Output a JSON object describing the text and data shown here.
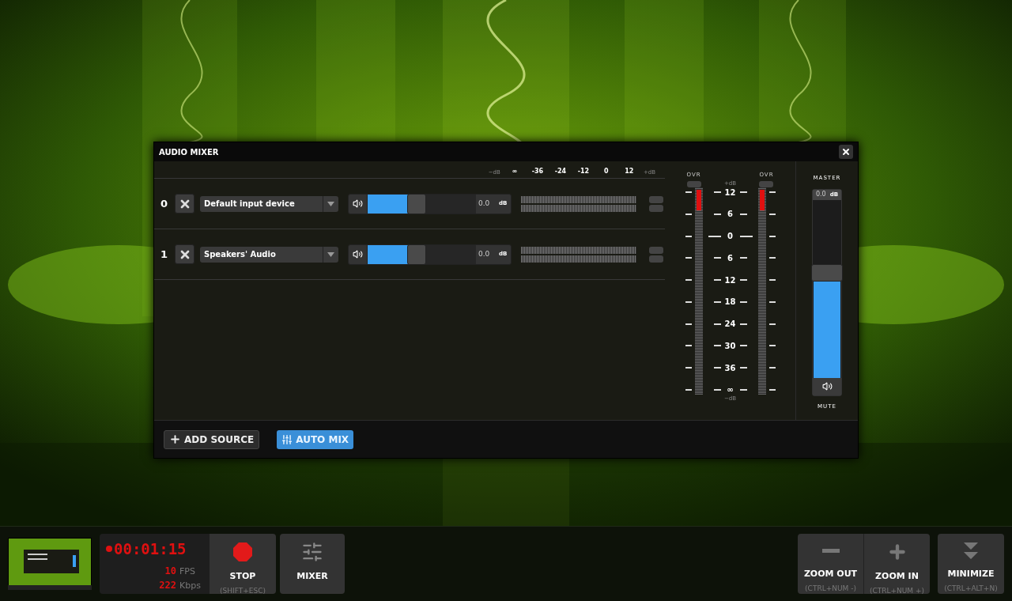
{
  "window": {
    "title": "AUDIO MIXER"
  },
  "channel_scale": {
    "left_unit": "−dB",
    "ticks": [
      "∞",
      "-36",
      "-24",
      "-12",
      "0",
      "12"
    ],
    "right_unit": "+dB"
  },
  "channels": [
    {
      "index": "0",
      "name": "Default input device",
      "level": 0.45,
      "reading": "0.0",
      "unit": "dB"
    },
    {
      "index": "1",
      "name": "Speakers' Audio",
      "level": 0.45,
      "reading": "0.0",
      "unit": "dB"
    }
  ],
  "output_meter": {
    "top_unit": "+dB",
    "bottom_unit": "−dB",
    "scale": [
      "12",
      "6",
      "0",
      "6",
      "12",
      "18",
      "24",
      "30",
      "36",
      "∞"
    ],
    "meters": [
      {
        "label": "OVR",
        "level": 0.1
      },
      {
        "label": "OVR",
        "level": 0.1
      }
    ]
  },
  "master": {
    "label": "MASTER",
    "reading": "0.0",
    "unit": "dB",
    "level": 0.55,
    "mute_label": "MUTE"
  },
  "buttons": [
    {
      "kind": "add",
      "label": "ADD SOURCE",
      "selected": false
    },
    {
      "kind": "automix",
      "label": "AUTO MIX",
      "selected": true
    }
  ],
  "recorder": {
    "timer": "00:01:15",
    "fps": "10",
    "fps_unit": "FPS",
    "bitrate": "222",
    "bitrate_unit": "Kbps"
  },
  "toolbar": [
    {
      "kind": "stop",
      "label": "STOP",
      "shortcut": "(SHIFT+ESC)"
    },
    {
      "kind": "mixer",
      "label": "MIXER"
    },
    {
      "kind": "zoom_out",
      "label": "ZOOM OUT",
      "shortcut": "(CTRL+NUM -)"
    },
    {
      "kind": "zoom_in",
      "label": "ZOOM IN",
      "shortcut": "(CTRL+NUM +)"
    },
    {
      "kind": "minimize",
      "label": "MINIMIZE",
      "shortcut": "(CTRL+ALT+N)"
    }
  ]
}
